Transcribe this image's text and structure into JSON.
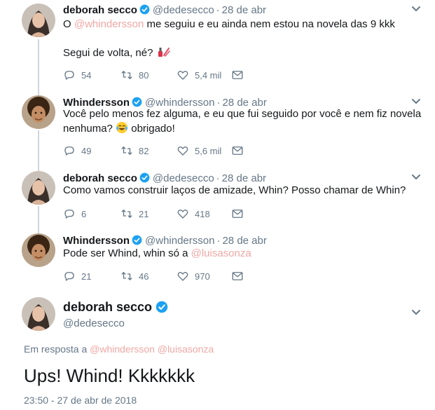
{
  "tweets": [
    {
      "name": "deborah secco",
      "handle": "@dedesecco",
      "dot": "·",
      "time": "28 de abr",
      "line1_pre": "O ",
      "line1_mention": "@whindersson",
      "line1_post": " me seguiu e eu ainda nem estou na novela das 9 kkk",
      "line2": "Segui de volta, né? ",
      "emoji": "nail-polish-emoji",
      "replies": "54",
      "retweets": "80",
      "likes": "5,4 mil"
    },
    {
      "name": "Whindersson",
      "handle": "@whindersson",
      "dot": "·",
      "time": "28 de abr",
      "line1": "Você pelo menos fez alguma, e eu que fui seguido por você e nem fiz novela",
      "line2_pre": "nenhuma? ",
      "emoji": "tears-of-joy-emoji",
      "line2_post": " obrigado!",
      "replies": "49",
      "retweets": "82",
      "likes": "5,6 mil"
    },
    {
      "name": "deborah secco",
      "handle": "@dedesecco",
      "dot": "·",
      "time": "28 de abr",
      "line1": "Como vamos construir laços de amizade, Whin? Posso chamar de Whin?",
      "replies": "6",
      "retweets": "21",
      "likes": "418"
    },
    {
      "name": "Whindersson",
      "handle": "@whindersson",
      "dot": "·",
      "time": "28 de abr",
      "line1_pre": "Pode ser Whind, whin só a ",
      "line1_mention": "@luisasonza",
      "replies": "21",
      "retweets": "46",
      "likes": "970"
    }
  ],
  "main": {
    "name": "deborah secco",
    "handle": "@dedesecco",
    "reply_prefix": "Em resposta a ",
    "reply_mention_1": "@whindersson",
    "reply_mention_2": "@luisasonza",
    "text": "Ups! Whind! Kkkkkkk",
    "timestamp": "23:50 - 27 de abr de 2018"
  },
  "colors": {
    "verified": "#1da1f2",
    "mention": "#f0a8a4",
    "secondary_text": "#657786",
    "thread_line": "#ccd6dd"
  },
  "icons": [
    "reply-icon",
    "retweet-icon",
    "like-icon",
    "direct-message-icon",
    "verified-badge-icon",
    "chevron-down-icon"
  ]
}
